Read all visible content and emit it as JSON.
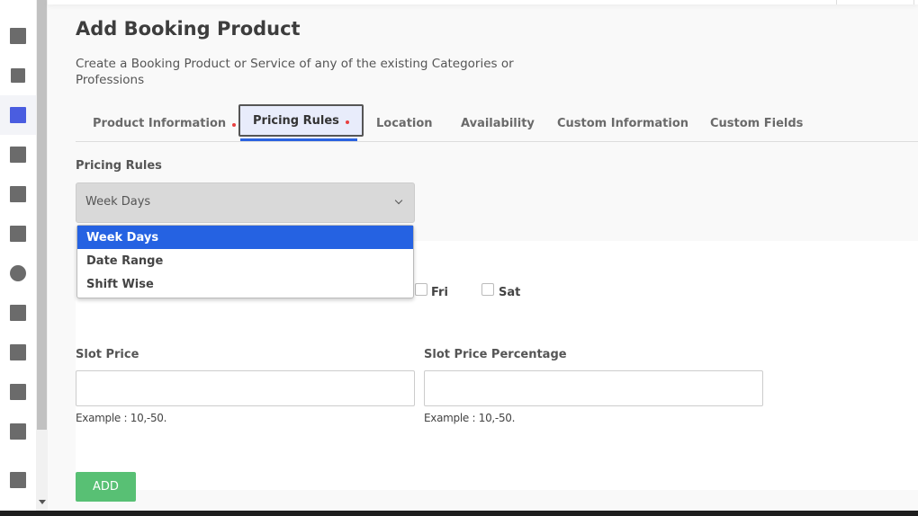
{
  "sidebar": {
    "items": [
      {
        "icon": "dashboard-icon"
      },
      {
        "icon": "hierarchy-icon"
      },
      {
        "icon": "calendar-icon",
        "active": true
      },
      {
        "icon": "list-icon"
      },
      {
        "icon": "document-icon"
      },
      {
        "icon": "grid-icon"
      },
      {
        "icon": "user-icon"
      },
      {
        "icon": "star-icon"
      },
      {
        "icon": "group-icon"
      },
      {
        "icon": "puzzle-icon"
      },
      {
        "icon": "settings-icon"
      },
      {
        "icon": "download-icon"
      }
    ]
  },
  "header": {
    "title": "Add Booking Product",
    "description": "Create a Booking Product or Service of any of the existing Categories or Professions"
  },
  "tabs": [
    {
      "label": "Product Information",
      "required": true
    },
    {
      "label": "Pricing Rules",
      "required": true,
      "active": true
    },
    {
      "label": "Location"
    },
    {
      "label": "Availability"
    },
    {
      "label": "Custom Information"
    },
    {
      "label": "Custom Fields"
    }
  ],
  "form": {
    "pricing_rules_label": "Pricing Rules",
    "pricing_rules_value": "Week Days",
    "options": [
      "Week Days",
      "Date Range",
      "Shift Wise"
    ],
    "days": [
      {
        "label": "Fri",
        "checked": false
      },
      {
        "label": "Sat",
        "checked": false
      }
    ],
    "slot_price_label": "Slot Price",
    "slot_price_value": "",
    "slot_price_hint": "Example : 10,-50.",
    "slot_pct_label": "Slot Price Percentage",
    "slot_pct_value": "",
    "slot_pct_hint": "Example : 10,-50.",
    "add_label": "ADD"
  },
  "colors": {
    "accent": "#2562e2",
    "add_button": "#58c074",
    "required_dot": "#e84040"
  }
}
